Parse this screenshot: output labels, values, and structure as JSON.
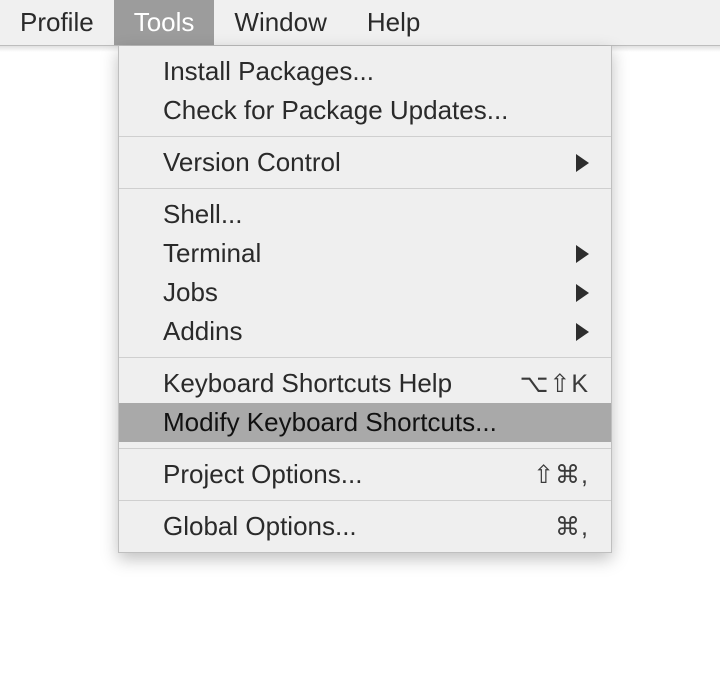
{
  "menubar": {
    "items": [
      {
        "label": "Profile"
      },
      {
        "label": "Tools"
      },
      {
        "label": "Window"
      },
      {
        "label": "Help"
      }
    ]
  },
  "dropdown": {
    "groups": [
      {
        "items": [
          {
            "label": "Install Packages...",
            "submenu": false
          },
          {
            "label": "Check for Package Updates...",
            "submenu": false
          }
        ]
      },
      {
        "items": [
          {
            "label": "Version Control",
            "submenu": true
          }
        ]
      },
      {
        "items": [
          {
            "label": "Shell...",
            "submenu": false
          },
          {
            "label": "Terminal",
            "submenu": true
          },
          {
            "label": "Jobs",
            "submenu": true
          },
          {
            "label": "Addins",
            "submenu": true
          }
        ]
      },
      {
        "items": [
          {
            "label": "Keyboard Shortcuts Help",
            "shortcut": "⌥⇧K",
            "submenu": false
          },
          {
            "label": "Modify Keyboard Shortcuts...",
            "submenu": false,
            "highlight": true
          }
        ]
      },
      {
        "items": [
          {
            "label": "Project Options...",
            "shortcut": "⇧⌘,",
            "submenu": false
          }
        ]
      },
      {
        "items": [
          {
            "label": "Global Options...",
            "shortcut": "⌘,",
            "submenu": false
          }
        ]
      }
    ]
  }
}
